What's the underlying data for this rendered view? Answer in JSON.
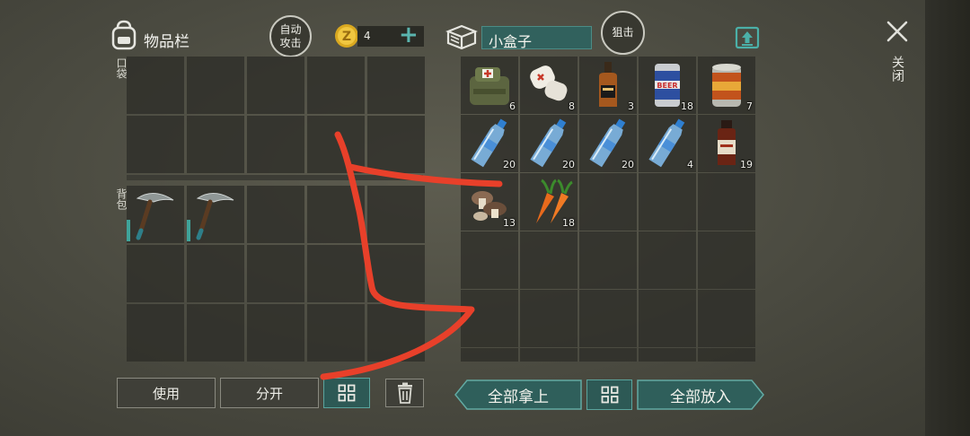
{
  "header": {
    "inventory_title": "物品栏",
    "auto_attack_label": "自动攻击",
    "coin_count": "4",
    "container_name": "小盒子",
    "snipe_label": "狙击",
    "close_label": "关闭"
  },
  "inventory": {
    "pocket_label": "口袋",
    "backpack_label": "背包",
    "backpack_items": [
      "pickaxe-icon",
      "pickaxe-icon"
    ]
  },
  "container": {
    "items": [
      {
        "icon": "first-aid-bag-icon",
        "count": "6"
      },
      {
        "icon": "bandage-icon",
        "count": "8"
      },
      {
        "icon": "whiskey-bottle-icon",
        "count": "3"
      },
      {
        "icon": "beer-can-icon",
        "count": "18"
      },
      {
        "icon": "canned-food-icon",
        "count": "7"
      },
      {
        "icon": "water-bottle-icon",
        "count": "20"
      },
      {
        "icon": "water-bottle-icon",
        "count": "20"
      },
      {
        "icon": "water-bottle-icon",
        "count": "20"
      },
      {
        "icon": "water-bottle-icon",
        "count": "4"
      },
      {
        "icon": "medicine-bottle-icon",
        "count": "19"
      },
      {
        "icon": "mushroom-icon",
        "count": "13"
      },
      {
        "icon": "carrot-icon",
        "count": "18"
      }
    ]
  },
  "buttons": {
    "use": "使用",
    "split": "分开",
    "take_all": "全部拿上",
    "put_all": "全部放入"
  },
  "colors": {
    "accent_teal": "#31615d",
    "annotation_red": "#e8402a"
  }
}
